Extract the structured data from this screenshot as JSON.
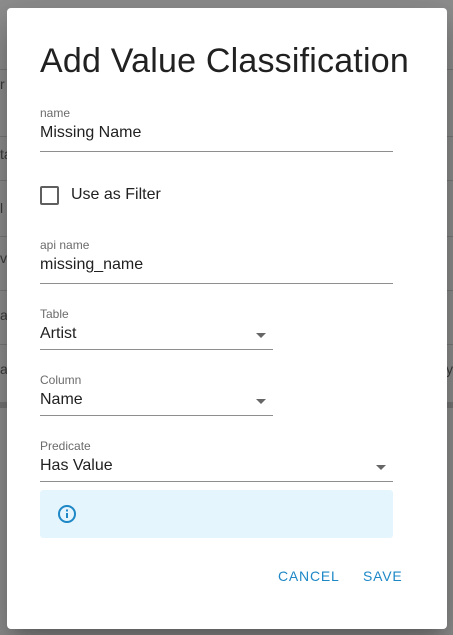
{
  "background": {
    "left_glyphs": [
      "r",
      "ta",
      "l",
      "v",
      "a",
      "a"
    ],
    "right_glyphs": [
      "y"
    ]
  },
  "dialog": {
    "title": "Add Value Classification",
    "name_field": {
      "label": "name",
      "value": "Missing Name"
    },
    "use_as_filter": {
      "label": "Use as Filter",
      "checked": false
    },
    "api_name_field": {
      "label": "api name",
      "value": "missing_name"
    },
    "table_select": {
      "label": "Table",
      "value": "Artist"
    },
    "column_select": {
      "label": "Column",
      "value": "Name"
    },
    "predicate_select": {
      "label": "Predicate",
      "value": "Has Value"
    },
    "info_box": {
      "icon": "info-icon",
      "text": ""
    },
    "actions": {
      "cancel_label": "CANCEL",
      "save_label": "SAVE"
    }
  },
  "colors": {
    "accent": "#1e88c7",
    "info_background": "#e5f5fd",
    "overlay": "#8f8f8f"
  }
}
